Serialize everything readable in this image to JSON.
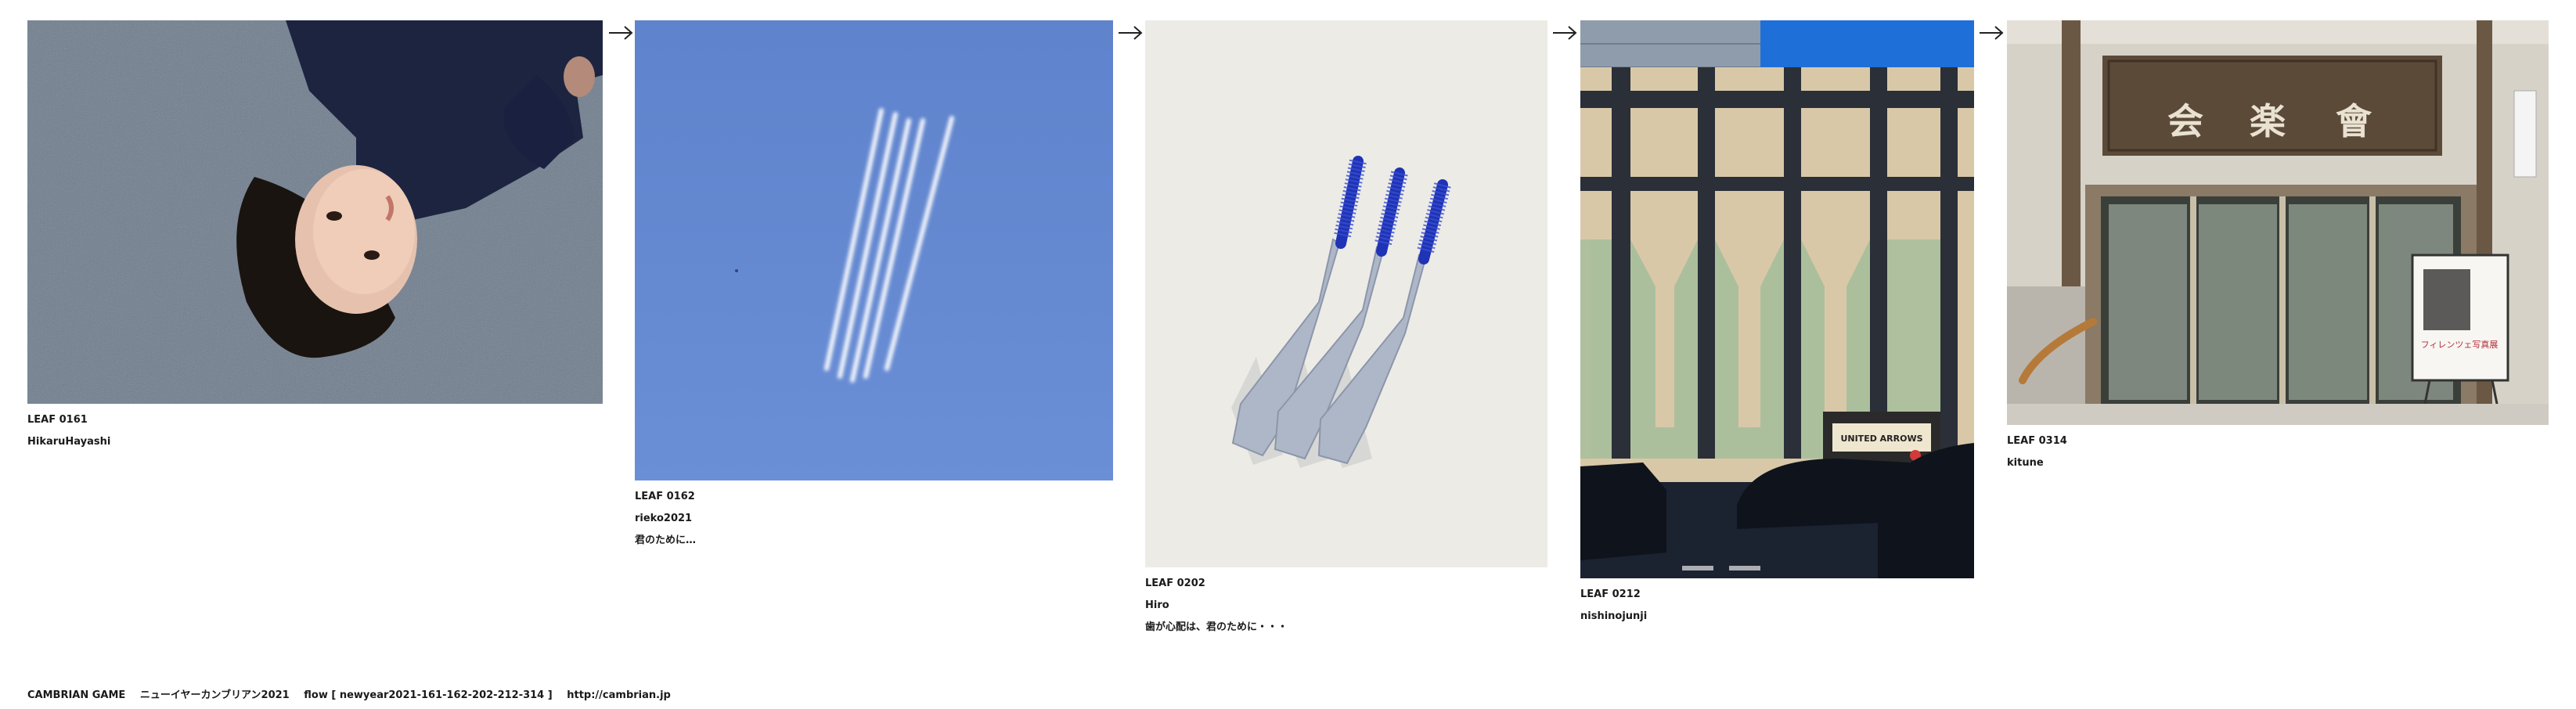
{
  "leaves": [
    {
      "id": "LEAF 0161",
      "author": "HikaruHayashi",
      "comment": ""
    },
    {
      "id": "LEAF 0162",
      "author": "rieko2021",
      "comment": "君のために…"
    },
    {
      "id": "LEAF 0202",
      "author": "Hiro",
      "comment": "歯が心配は、君のために・・・"
    },
    {
      "id": "LEAF 0212",
      "author": "nishinojunji",
      "comment": ""
    },
    {
      "id": "LEAF 0314",
      "author": "kitune",
      "comment": ""
    }
  ],
  "photo_texts": {
    "store_sign": "UNITED ARROWS",
    "poster_text": "フィレンツェ写真展"
  },
  "footer": {
    "title": "CAMBRIAN GAME",
    "subtitle": "ニューイヤーカンブリアン2021",
    "flow": "flow [ newyear2021-161-162-202-212-314 ]",
    "url": "http://cambrian.jp"
  },
  "icons": {
    "arrow": "right-arrow-icon"
  }
}
